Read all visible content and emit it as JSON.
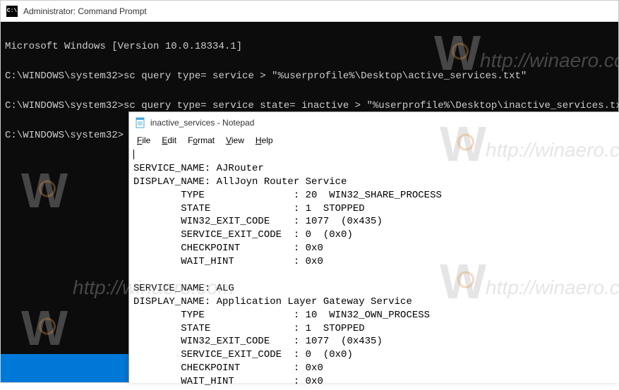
{
  "cmd": {
    "title": "Administrator: Command Prompt",
    "icon_label": "C:\\",
    "lines": {
      "l1": "Microsoft Windows [Version 10.0.18334.1]",
      "l2": "C:\\WINDOWS\\system32>sc query type= service > \"%userprofile%\\Desktop\\active_services.txt\"",
      "l3": "C:\\WINDOWS\\system32>sc query type= service state= inactive > \"%userprofile%\\Desktop\\inactive_services.txt\"",
      "l4": "C:\\WINDOWS\\system32>"
    }
  },
  "notepad": {
    "title": "inactive_services - Notepad",
    "menu": {
      "file": "File",
      "edit": "Edit",
      "format": "Format",
      "view": "View",
      "help": "Help"
    },
    "content": {
      "s1_name": "SERVICE_NAME: AJRouter",
      "s1_display": "DISPLAY_NAME: AllJoyn Router Service",
      "s1_type": "        TYPE               : 20  WIN32_SHARE_PROCESS",
      "s1_state": "        STATE              : 1  STOPPED",
      "s1_win32": "        WIN32_EXIT_CODE    : 1077  (0x435)",
      "s1_svc": "        SERVICE_EXIT_CODE  : 0  (0x0)",
      "s1_checkpoint": "        CHECKPOINT         : 0x0",
      "s1_wait": "        WAIT_HINT          : 0x0",
      "s2_name": "SERVICE_NAME: ALG",
      "s2_display": "DISPLAY_NAME: Application Layer Gateway Service",
      "s2_type": "        TYPE               : 10  WIN32_OWN_PROCESS",
      "s2_state": "        STATE              : 1  STOPPED",
      "s2_win32": "        WIN32_EXIT_CODE    : 1077  (0x435)",
      "s2_svc": "        SERVICE_EXIT_CODE  : 0  (0x0)",
      "s2_checkpoint": "        CHECKPOINT         : 0x0",
      "s2_wait": "        WAIT_HINT          : 0x0"
    }
  },
  "watermark_text": "http://winaero.com"
}
